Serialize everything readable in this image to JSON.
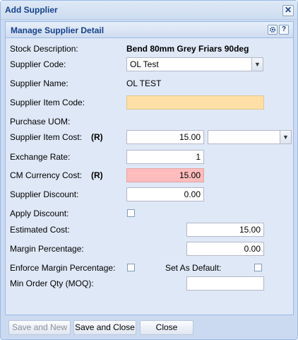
{
  "window": {
    "title": "Add Supplier",
    "close_glyph": "✕"
  },
  "panel": {
    "title": "Manage Supplier Detail",
    "settings_icon": "gear-icon",
    "help_glyph": "?"
  },
  "form": {
    "stock_description": {
      "label": "Stock Description:",
      "value": "Bend 80mm Grey Friars 90deg"
    },
    "supplier_code": {
      "label": "Supplier Code:",
      "value": "OL Test"
    },
    "supplier_name": {
      "label": "Supplier Name:",
      "value": "OL TEST"
    },
    "supplier_item_code": {
      "label": "Supplier Item Code:",
      "value": ""
    },
    "purchase_uom": {
      "label": "Purchase UOM:"
    },
    "supplier_item_cost": {
      "label": "Supplier Item Cost:",
      "marker": "(R)",
      "value": "15.00",
      "currency": ""
    },
    "exchange_rate": {
      "label": "Exchange Rate:",
      "value": "1"
    },
    "cm_currency_cost": {
      "label": "CM Currency Cost:",
      "marker": "(R)",
      "value": "15.00"
    },
    "supplier_discount": {
      "label": "Supplier Discount:",
      "value": "0.00"
    },
    "apply_discount": {
      "label": "Apply Discount:",
      "checked": false
    },
    "estimated_cost": {
      "label": "Estimated Cost:",
      "value": "15.00"
    },
    "margin_percentage": {
      "label": "Margin Percentage:",
      "value": "0.00"
    },
    "enforce_margin": {
      "label": "Enforce Margin Percentage:",
      "checked": false
    },
    "set_as_default": {
      "label": "Set As Default:",
      "checked": false
    },
    "moq": {
      "label": "Min Order Qty (MOQ):",
      "value": ""
    }
  },
  "footer": {
    "save_and_new": "Save and New",
    "save_and_close": "Save and Close",
    "close": "Close"
  },
  "colors": {
    "title": "#15428b",
    "yellow_field": "#ffdfa5",
    "pink_field": "#ffbcbc"
  }
}
